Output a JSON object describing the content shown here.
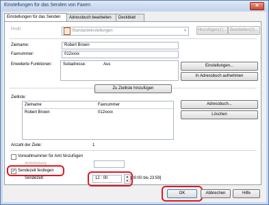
{
  "window": {
    "title": "Einstellungen für das Senden von Faxen",
    "close_glyph": "✕"
  },
  "tabs": [
    {
      "label": "Einstellungen für das Senden"
    },
    {
      "label": "Adressbuch bearbeiten"
    },
    {
      "label": "Deckblatt"
    }
  ],
  "profile": {
    "label": "Profil:",
    "value": "Standardeinstellungen"
  },
  "buttons": {
    "add_profile": "Hinzufügen(1)...",
    "edit_profile": "Bearbeiten(2)...",
    "settings": "Einstellungen...",
    "add_to_addressbook": "In Adressbuch aufnehmen",
    "add_to_list": "Zu Zielliste hinzufügen",
    "addressbook": "Adressbuch...",
    "delete": "Löschen",
    "ok": "OK",
    "cancel": "Abbrechen",
    "help": "Hilfe"
  },
  "fields": {
    "name_label": "Zielname:",
    "name_value": "Robert Brown",
    "fax_label": "Faxnummer:",
    "fax_value": "012xxxx",
    "ext_label": "Erweiterte Funktionen:",
    "subaddr_label": "Subadresse:",
    "subaddr_value": "Aus"
  },
  "destlist": {
    "label": "Zielliste:",
    "col_name": "Zielname",
    "col_fax": "Faxnummer",
    "rows": [
      {
        "name": "Robert Brown",
        "fax": "012xxxx"
      }
    ],
    "count_label": "Anzahl der Ziele:",
    "count_value": "1"
  },
  "options": {
    "prefix_label": "Vorwahlnummer für Amt hinzufügen",
    "prefix_sub": "Amtsholung",
    "sendtime_label": "Sendezeit festlegen",
    "sendtime_checked": true,
    "time_label": "Sendezeit:",
    "hour": "12",
    "minute": "00",
    "range": "[00:00 bis 23:59]"
  }
}
